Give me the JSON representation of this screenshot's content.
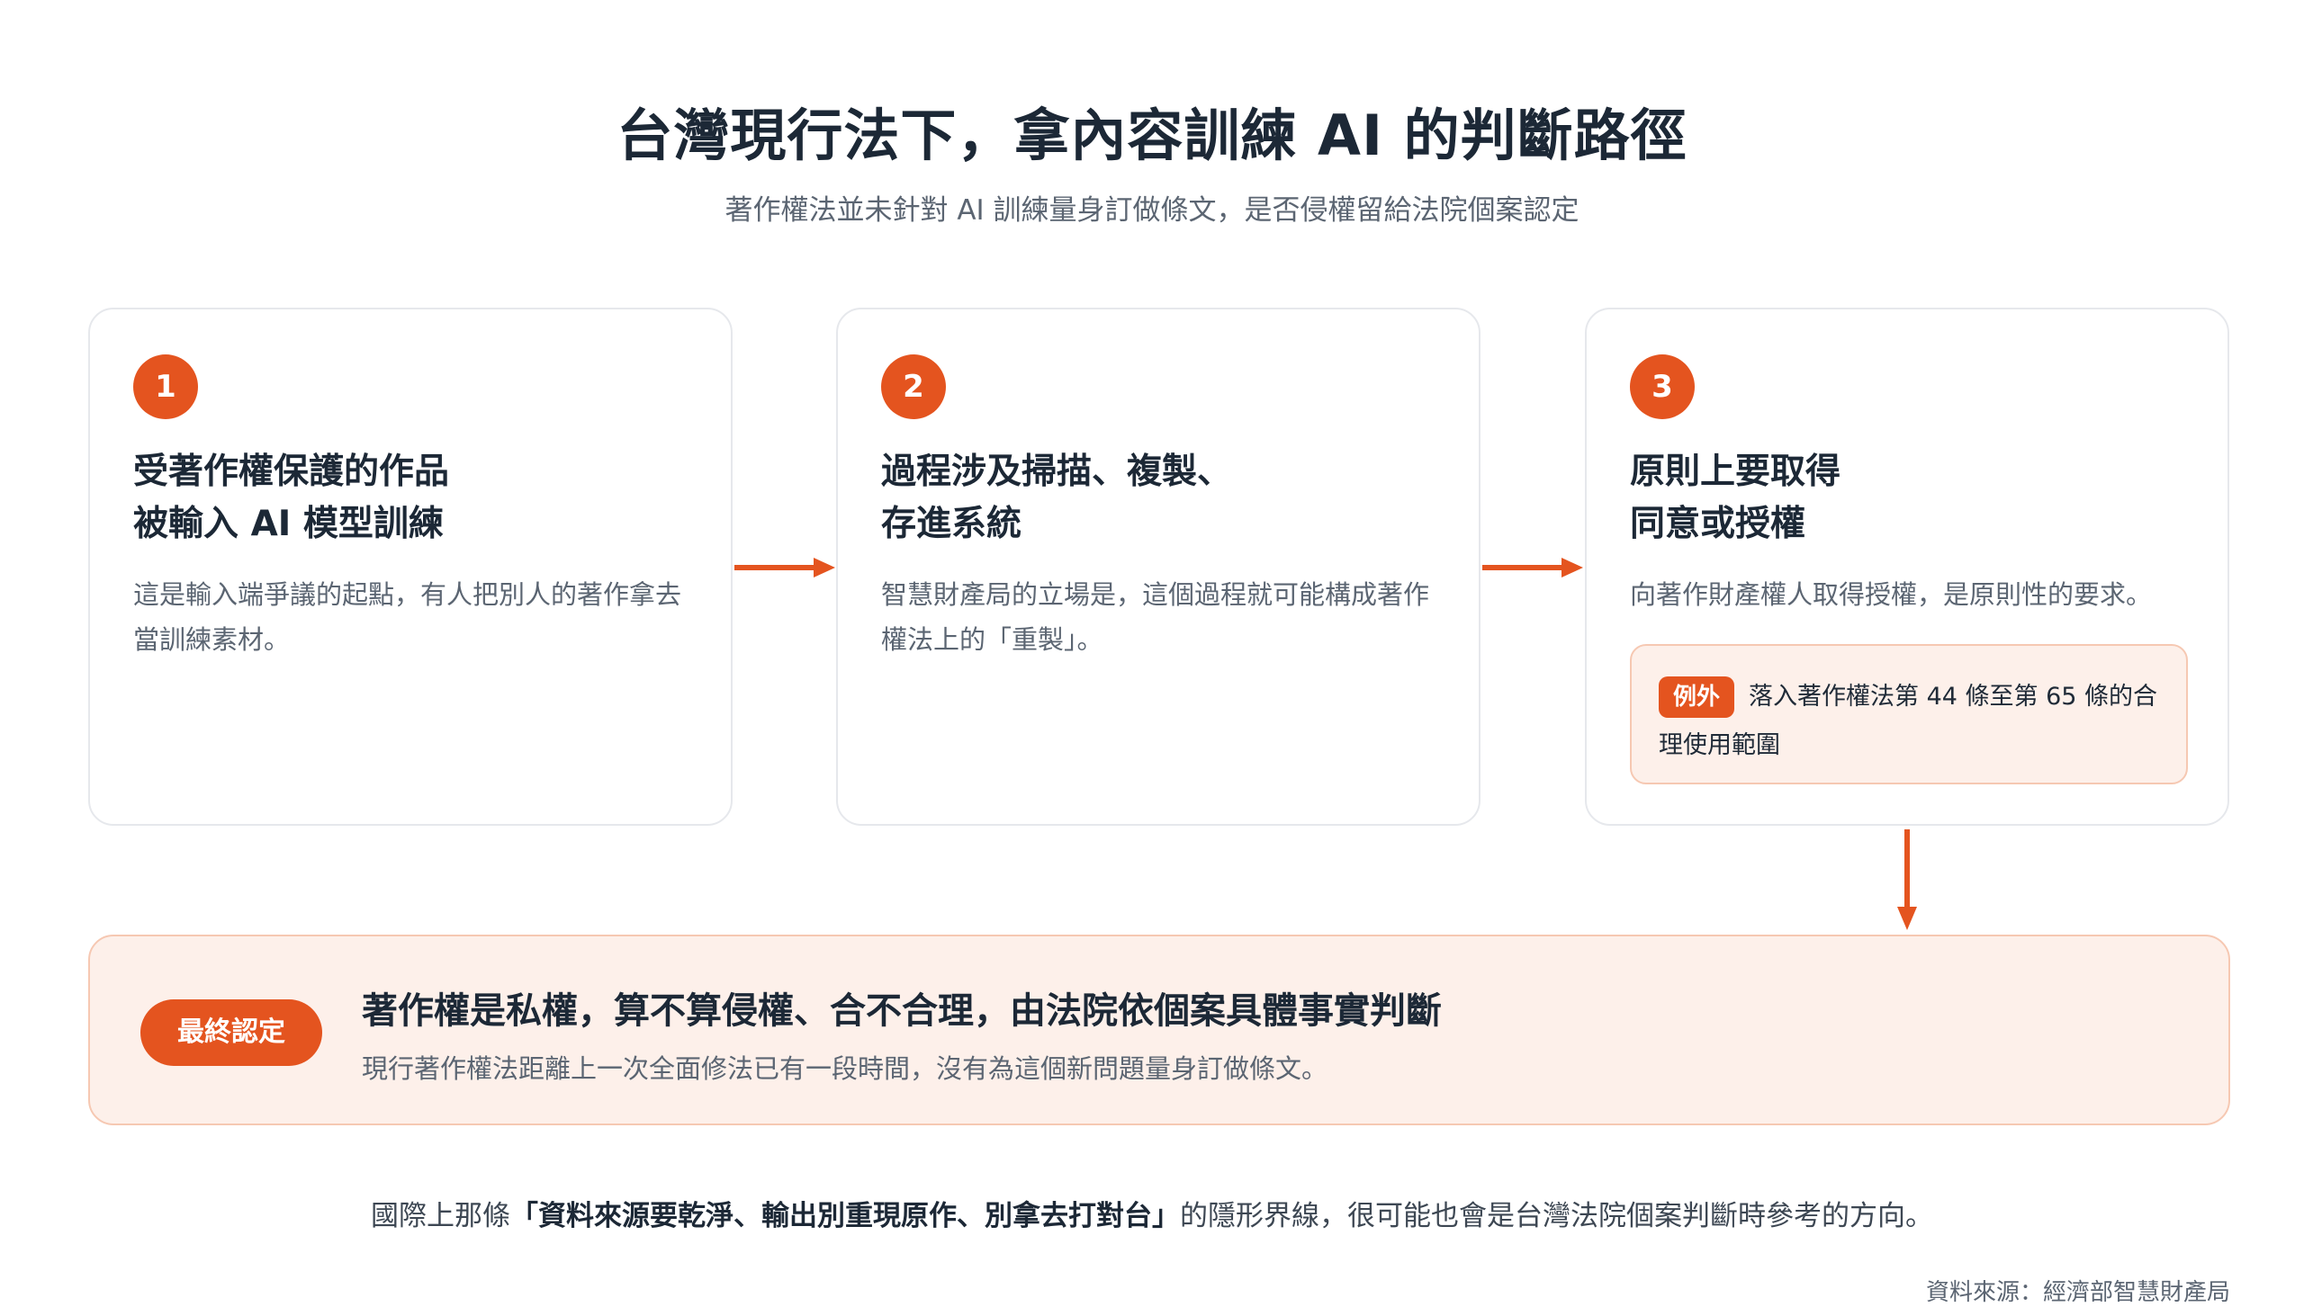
{
  "header": {
    "title": "台灣現行法下，拿內容訓練 AI 的判斷路徑",
    "subtitle": "著作權法並未針對 AI 訓練量身訂做條文，是否侵權留給法院個案認定"
  },
  "steps": [
    {
      "number": "1",
      "title_line1": "受著作權保護的作品",
      "title_line2": "被輸入 AI 模型訓練",
      "description": "這是輸入端爭議的起點，有人把別人的著作拿去當訓練素材。"
    },
    {
      "number": "2",
      "title_line1": "過程涉及掃描、複製、",
      "title_line2": "存進系統",
      "description": "智慧財產局的立場是，這個過程就可能構成著作權法上的「重製」。"
    },
    {
      "number": "3",
      "title_line1": "原則上要取得",
      "title_line2": "同意或授權",
      "description": "向著作財產權人取得授權，是原則性的要求。",
      "exception": {
        "tag": "例外",
        "text": "落入著作權法第 44 條至第 65 條的合理使用範圍"
      }
    }
  ],
  "final": {
    "tag": "最終認定",
    "title": "著作權是私權，算不算侵權、合不合理，由法院依個案具體事實判斷",
    "description": "現行著作權法距離上一次全面修法已有一段時間，沒有為這個新問題量身訂做條文。"
  },
  "footnote": {
    "prefix": "國際上那條",
    "highlight": "「資料來源要乾淨、輸出別重現原作、別拿去打對台」",
    "suffix": "的隱形界線，很可能也會是台灣法院個案判斷時參考的方向。"
  },
  "source": "資料來源：經濟部智慧財產局",
  "colors": {
    "accent": "#e4541f",
    "accent_soft": "#fdf0ea",
    "accent_border": "#f6c8b2",
    "text_dark": "#1c2836",
    "text_muted": "#5b6572",
    "card_border": "#e6e8ec"
  }
}
